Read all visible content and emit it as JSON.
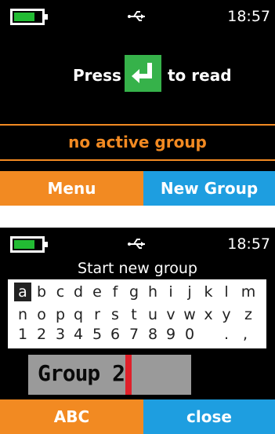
{
  "screen1": {
    "status": {
      "time": "18:57",
      "battery_icon": "battery-icon",
      "usb_icon": "usb-icon",
      "battery_level": 0.65
    },
    "prompt": {
      "press": "Press",
      "to_read": "to read"
    },
    "group_status": "no active group",
    "softkeys": {
      "left": "Menu",
      "right": "New Group"
    }
  },
  "screen2": {
    "status": {
      "time": "18:57",
      "battery_icon": "battery-icon",
      "usb_icon": "usb-icon",
      "battery_level": 0.65
    },
    "title": "Start new group",
    "keyboard": {
      "rows": [
        [
          "a",
          "b",
          "c",
          "d",
          "e",
          "f",
          "g",
          "h",
          "i",
          "j",
          "k",
          "l",
          "m"
        ],
        [
          "n",
          "o",
          "p",
          "q",
          "r",
          "s",
          "t",
          "u",
          "v",
          "w",
          "x",
          "y",
          "z"
        ],
        [
          "1",
          "2",
          "3",
          "4",
          "5",
          "6",
          "7",
          "8",
          "9",
          "0",
          "",
          ".",
          ","
        ]
      ],
      "selected": "a"
    },
    "input_value": "Group 2",
    "softkeys": {
      "left": "ABC",
      "right": "close"
    }
  },
  "colors": {
    "orange": "#f28a22",
    "blue": "#1e9ee0",
    "green": "#36b24a",
    "battery": "#22bb33",
    "cursor": "#e0202a"
  }
}
